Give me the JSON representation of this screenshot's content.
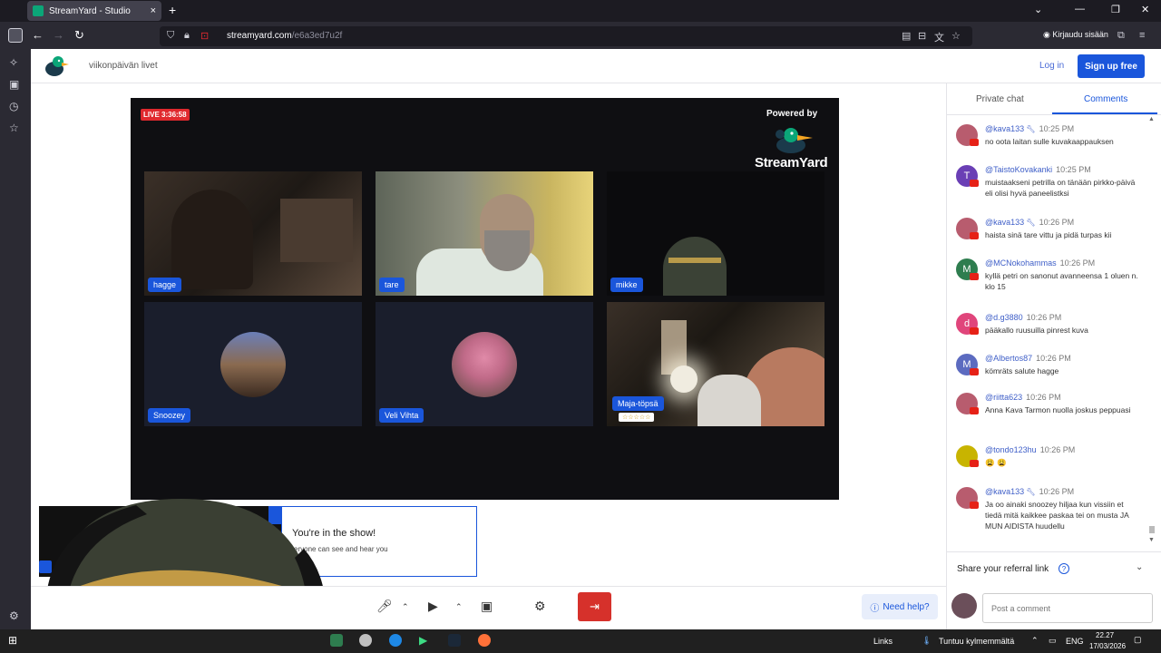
{
  "browser": {
    "tab_title": "StreamYard - Studio",
    "tab_close": "×",
    "new_tab": "+",
    "url_domain": "streamyard.com",
    "url_path": "/e6a3ed7u2f",
    "signin_label": "Kirjaudu sisään",
    "window_controls": [
      "⌄",
      "—",
      "❐",
      "✕"
    ]
  },
  "header": {
    "broadcast_name": "viikonpäivän livet",
    "login_label": "Log in",
    "signup_label": "Sign up free"
  },
  "stage": {
    "live_badge": "LIVE 3:36:58",
    "powered_by": "Powered by",
    "brand_word": "StreamYard",
    "participants": [
      {
        "name": "hagge"
      },
      {
        "name": "tare"
      },
      {
        "name": "mikke"
      },
      {
        "name": "Snoozey"
      },
      {
        "name": "Veli Vihta"
      },
      {
        "name": "Maja-töpsä",
        "stars": "☆☆☆☆☆"
      }
    ]
  },
  "notice": {
    "title": "You're in the show!",
    "subtitle": "eryone can see and hear you"
  },
  "controls": {
    "help_label": "Need help?",
    "leave_icon": "⇥"
  },
  "panel": {
    "tabs": [
      "Private chat",
      "Comments"
    ],
    "active_tab": "Comments",
    "comments": [
      {
        "user": "@kava133",
        "mod": true,
        "time": "10:25 PM",
        "text": "no oota laitan sulle kuvakaappauksen",
        "color": "#b85c6e",
        "initial": ""
      },
      {
        "user": "@TaistoKovakanki",
        "mod": false,
        "time": "10:25 PM",
        "text": "muistaakseni petrilla on tänään pirkko-päivä eli olisi hyvä paneelistksi",
        "color": "#6a3fb5",
        "initial": "T"
      },
      {
        "user": "@kava133",
        "mod": true,
        "time": "10:26 PM",
        "text": "haista sinä tare vittu ja pidä turpas kii",
        "color": "#b85c6e",
        "initial": ""
      },
      {
        "user": "@MCNokohammas",
        "mod": false,
        "time": "10:26 PM",
        "text": "kyllä petri on sanonut avanneensa 1 oluen n. klo 15",
        "color": "#2e7d4f",
        "initial": "M"
      },
      {
        "user": "@d.g3880",
        "mod": false,
        "time": "10:26 PM",
        "text": "pääkallo ruusuilla pinrest kuva",
        "color": "#e0457b",
        "initial": "d"
      },
      {
        "user": "@Albertos87",
        "mod": false,
        "time": "10:26 PM",
        "text": "kömräts salute hagge",
        "color": "#5c6bc0",
        "initial": "M"
      },
      {
        "user": "@riitta623",
        "mod": false,
        "time": "10:26 PM",
        "text": "Anna Kava Tarmon nuolla joskus peppuasi",
        "color": "#b85c6e",
        "initial": ""
      },
      {
        "user": "@tondo123hu",
        "mod": false,
        "time": "10:26 PM",
        "text": "😩 😩",
        "color": "#c8b400",
        "initial": ""
      },
      {
        "user": "@kava133",
        "mod": true,
        "time": "10:26 PM",
        "text": "Ja oo ainaki snoozey hiljaa kun vissiin et tiedä mitä kaikkee paskaa tei on musta JA MUN AIDISTA huudellu",
        "color": "#b85c6e",
        "initial": ""
      }
    ],
    "share_label": "Share your referral link",
    "post_placeholder": "Post a comment"
  },
  "taskbar": {
    "links_label": "Links",
    "weather": "Tuntuu kylmemmältä",
    "lang": "ENG",
    "time": "22.27",
    "date": "17/03/2026"
  },
  "colors": {
    "accent": "#1a56db",
    "live": "#e0292e",
    "leave": "#d6312b"
  }
}
